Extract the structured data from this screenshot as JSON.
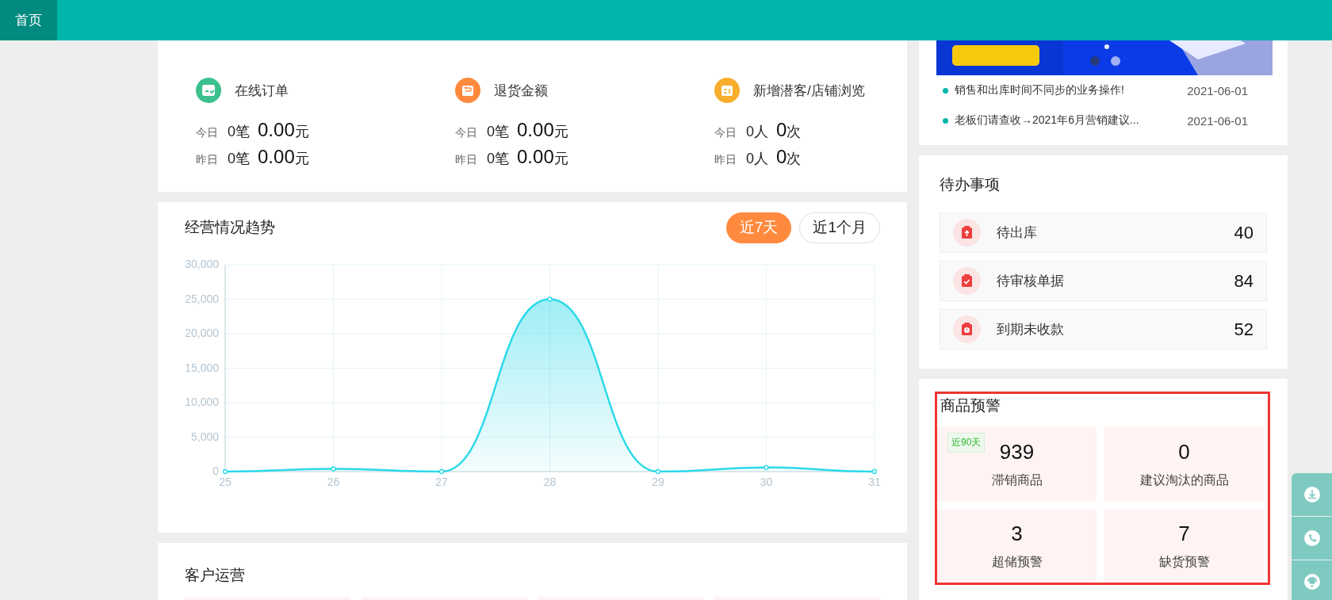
{
  "header": {
    "tabs": [
      {
        "label": "首页",
        "selected": true
      }
    ]
  },
  "business": {
    "metrics": [
      {
        "kind": "order",
        "label": "在线订单",
        "rows": [
          {
            "day": "今日",
            "count": "0笔",
            "amount": "0.00",
            "unit": "元"
          },
          {
            "day": "昨日",
            "count": "0笔",
            "amount": "0.00",
            "unit": "元"
          }
        ]
      },
      {
        "kind": "refund",
        "label": "退货金额",
        "rows": [
          {
            "day": "今日",
            "count": "0笔",
            "amount": "0.00",
            "unit": "元"
          },
          {
            "day": "昨日",
            "count": "0笔",
            "amount": "0.00",
            "unit": "元"
          }
        ]
      },
      {
        "kind": "visitor",
        "label": "新增潜客/店铺浏览",
        "rows": [
          {
            "day": "今日",
            "count": "0人",
            "amount": "0",
            "unit": "次"
          },
          {
            "day": "昨日",
            "count": "0人",
            "amount": "0",
            "unit": "次"
          }
        ]
      }
    ]
  },
  "trend": {
    "title": "经营情况趋势",
    "ranges": [
      {
        "label": "近7天",
        "selected": true
      },
      {
        "label": "近1个月",
        "selected": false
      }
    ],
    "chart_data": {
      "type": "area",
      "categories": [
        "25",
        "26",
        "27",
        "28",
        "29",
        "30",
        "31"
      ],
      "grid": true,
      "series": [
        {
          "color": "#2bd9e8",
          "values": [
            0,
            400,
            0,
            25000,
            0,
            600,
            0
          ]
        }
      ],
      "ylim": [
        0,
        30000
      ],
      "yticks": [
        {
          "value": 0,
          "label": "0"
        },
        {
          "value": 5000,
          "label": "5,000"
        },
        {
          "value": 10000,
          "label": "10,000"
        },
        {
          "value": 15000,
          "label": "15,000"
        },
        {
          "value": 20000,
          "label": "20,000"
        },
        {
          "value": 25000,
          "label": "25,000"
        },
        {
          "value": 30000,
          "label": "30,000"
        }
      ]
    }
  },
  "customer_ops": {
    "title": "客户运营",
    "tiles": [
      {
        "kind": "blank"
      },
      {
        "kind": "blank"
      },
      {
        "kind": "blank"
      },
      {
        "kind": "blank"
      }
    ]
  },
  "news": {
    "items": [
      {
        "title": "销售和出库时间不同步的业务操作!",
        "date": "2021-06-01"
      },
      {
        "title": "老板们请查收→2021年6月营销建议...",
        "date": "2021-06-01"
      }
    ]
  },
  "todo": {
    "title": "待办事项",
    "items": [
      {
        "kind": "outbound",
        "label": "待出库",
        "count": "40"
      },
      {
        "kind": "review",
        "label": "待审核单据",
        "count": "84"
      },
      {
        "kind": "overdue",
        "label": "到期未收款",
        "count": "52"
      }
    ]
  },
  "warning": {
    "title": "商品预警",
    "tiles": [
      {
        "value": "939",
        "label": "滞销商品",
        "tag": "近90天"
      },
      {
        "value": "0",
        "label": "建议淘汰的商品"
      },
      {
        "value": "3",
        "label": "超储预警"
      },
      {
        "value": "7",
        "label": "缺货预警"
      }
    ]
  },
  "float_buttons": [
    {
      "kind": "download"
    },
    {
      "kind": "phone"
    },
    {
      "kind": "service"
    }
  ]
}
